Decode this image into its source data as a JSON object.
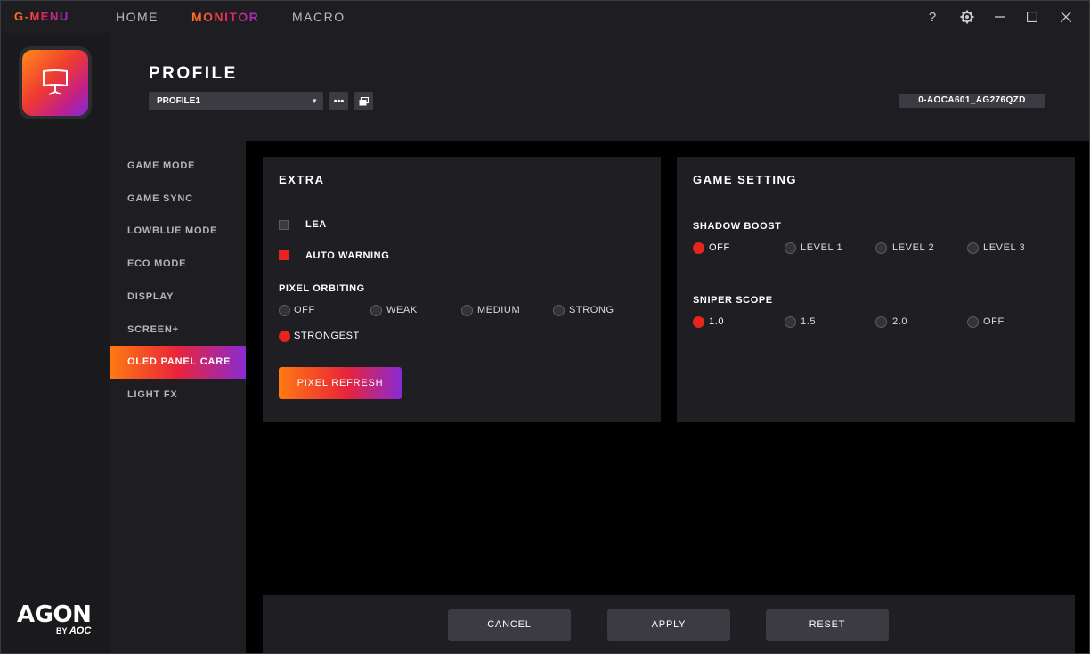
{
  "titlebar": {
    "brand": "G-MENU",
    "tabs": [
      {
        "label": "HOME"
      },
      {
        "label": "MONITOR"
      },
      {
        "label": "MACRO"
      }
    ],
    "help_label": "?"
  },
  "header": {
    "title": "PROFILE",
    "profile_value": "PROFILE1",
    "device_id": "0-AOCA601_AG276QZD"
  },
  "sidemenu": {
    "items": [
      {
        "label": "GAME MODE"
      },
      {
        "label": "GAME SYNC"
      },
      {
        "label": "LOWBLUE MODE"
      },
      {
        "label": "ECO MODE"
      },
      {
        "label": "DISPLAY"
      },
      {
        "label": "SCREEN+"
      },
      {
        "label": "OLED PANEL CARE"
      },
      {
        "label": "LIGHT FX"
      }
    ],
    "active_index": 6
  },
  "extra": {
    "title": "EXTRA",
    "lea": {
      "label": "LEA",
      "checked": false
    },
    "auto_warning": {
      "label": "AUTO WARNING",
      "checked": true
    },
    "pixel_orbiting": {
      "label": "PIXEL ORBITING",
      "options": [
        "OFF",
        "WEAK",
        "MEDIUM",
        "STRONG",
        "STRONGEST"
      ],
      "selected": "STRONGEST"
    },
    "pixel_refresh_label": "PIXEL REFRESH"
  },
  "game_setting": {
    "title": "GAME SETTING",
    "shadow_boost": {
      "label": "SHADOW BOOST",
      "options": [
        "OFF",
        "LEVEL 1",
        "LEVEL 2",
        "LEVEL 3"
      ],
      "selected": "OFF"
    },
    "sniper_scope": {
      "label": "SNIPER SCOPE",
      "options": [
        "1.0",
        "1.5",
        "2.0",
        "OFF"
      ],
      "selected": "1.0"
    }
  },
  "footer": {
    "cancel_label": "CANCEL",
    "apply_label": "APPLY",
    "reset_label": "RESET"
  },
  "logo": {
    "agon": "AGON",
    "by": "BY",
    "aoc": "AOC"
  },
  "colors": {
    "accent_red": "#e8241f",
    "gradient_start": "#ff7a12",
    "gradient_mid": "#e8243a",
    "gradient_end": "#8a2ad2"
  }
}
